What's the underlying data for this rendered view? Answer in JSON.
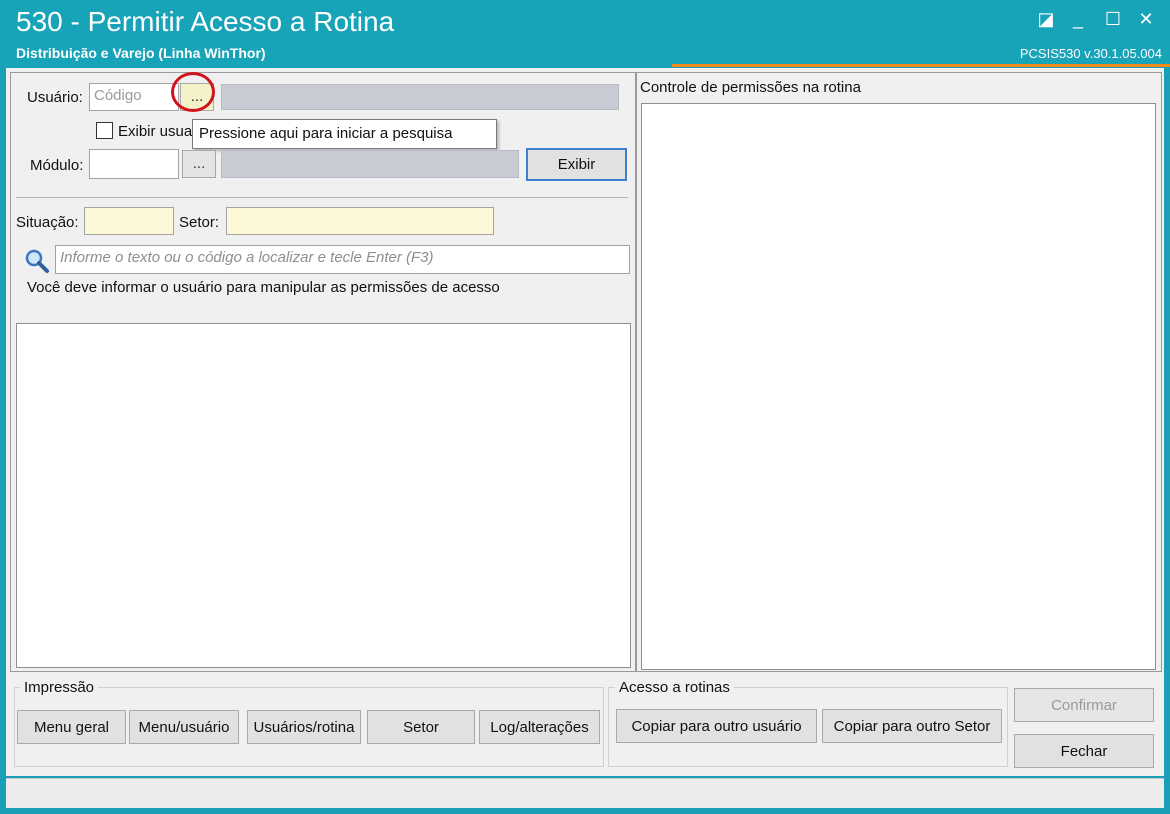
{
  "window": {
    "title": "530 - Permitir Acesso a Rotina",
    "subtitle": "Distribuição e Varejo (Linha WinThor)",
    "version": "PCSIS530  v.30.1.05.004",
    "controls": {
      "restore_glyph": "◪",
      "minimize_glyph": "_",
      "maximize_glyph": "☐",
      "close_glyph": "✕"
    }
  },
  "form": {
    "usuario_label": "Usuário:",
    "usuario_code_placeholder": "Código",
    "dots": "...",
    "exibir_label": "Exibir usua",
    "modulo_label": "Módulo:",
    "exibir_button": "Exibir",
    "situacao_label": "Situação:",
    "setor_label": "Setor:",
    "search_placeholder": "Informe o texto ou o código a localizar e tecle Enter (F3)",
    "info_message": "Você deve informar o usuário para manipular as permissões de acesso"
  },
  "tooltip": {
    "text": "Pressione aqui para iniciar a pesquisa"
  },
  "permissions": {
    "title": "Controle de permissões na rotina"
  },
  "impressao": {
    "title": "Impressão",
    "buttons": [
      "Menu geral",
      "Menu/usuário",
      "Usuários/rotina",
      "Setor",
      "Log/alterações"
    ]
  },
  "acesso": {
    "title": "Acesso a rotinas",
    "buttons": [
      "Copiar para outro usuário",
      "Copiar para outro Setor"
    ]
  },
  "actions": {
    "confirmar": "Confirmar",
    "fechar": "Fechar"
  },
  "colors": {
    "titlebar": "#17a3b8",
    "accent_line": "#f08a1c",
    "highlight_circle": "#d1141b",
    "yellow_field": "#fdf8d6"
  }
}
